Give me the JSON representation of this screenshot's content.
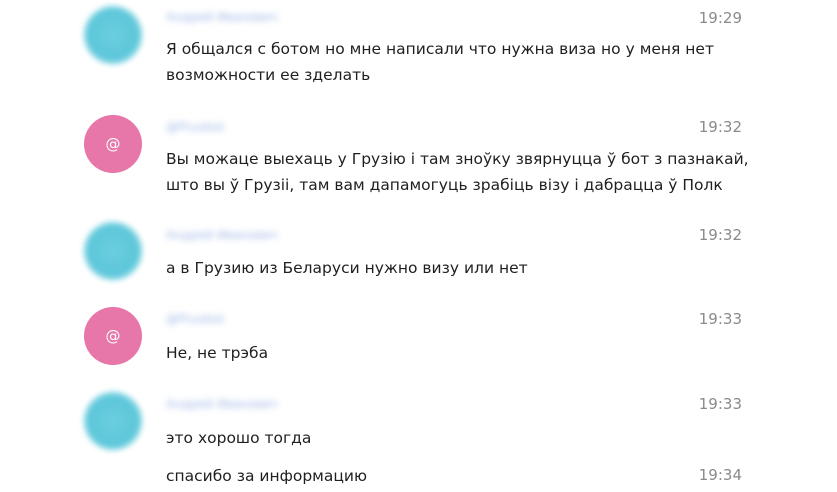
{
  "messages": [
    {
      "author": "Андрей Иванович",
      "avatar": "",
      "time": "19:29",
      "text": "Я общался с ботом но мне написали что нужна виза но у меня нет\nвозможности ее зделать"
    },
    {
      "author": "@Pruxbot",
      "avatar": "@",
      "time": "19:32",
      "text": "Вы можаце выехаць у Грузію і там зноўку звярнуцца ў бот з пазнакай,\nшто вы ў Грузіі, там вам дапамогуць зрабіць візу і дабрацца ў Полк"
    },
    {
      "author": "Андрей Иванович",
      "avatar": "",
      "time": "19:32",
      "text": "а в Грузию из Беларуси нужно визу или нет"
    },
    {
      "author": "@Pruxbot",
      "avatar": "@",
      "time": "19:33",
      "text": "Не, не трэба"
    },
    {
      "author": "Андрей Иванович",
      "avatar": "",
      "time": "19:33",
      "text": "это хорошо тогда"
    },
    {
      "author": "",
      "avatar": "",
      "time": "19:34",
      "text": "спасибо за информацию"
    }
  ]
}
